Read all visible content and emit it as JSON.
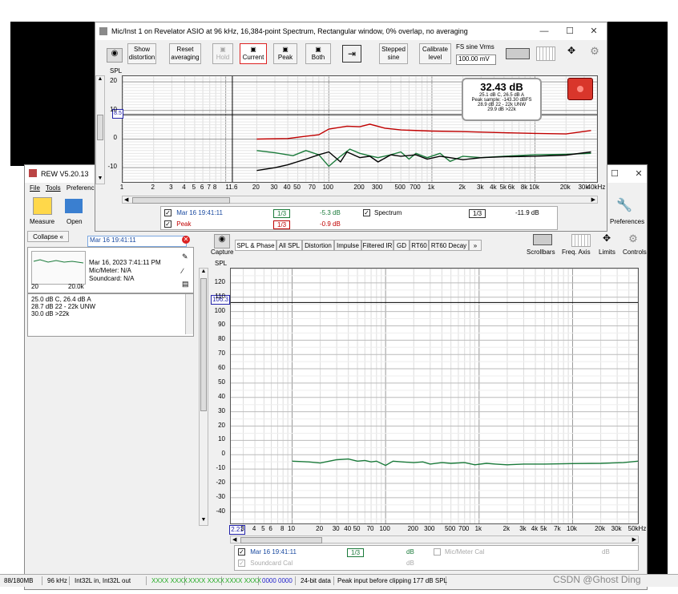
{
  "rta_window": {
    "title": "Mic/Inst 1 on Revelator ASIO at 96 kHz, 16,384-point Spectrum, Rectangular window, 0% overlap, no averaging",
    "buttons": {
      "show_distortion": "Show distortion",
      "reset_averaging": "Reset averaging",
      "hold": "Hold",
      "current": "Current",
      "peak": "Peak",
      "both": "Both",
      "stepped_sine": "Stepped sine",
      "calibrate_level": "Calibrate level"
    },
    "fs_sine_label": "FS sine Vrms",
    "fs_sine_value": "100.00 mV",
    "axis_label": "SPL",
    "y_ticks": [
      "20",
      "10",
      "0",
      "-10"
    ],
    "x_ticks": [
      "1",
      "2",
      "3",
      "4",
      "5",
      "6",
      "7",
      "8",
      "11.6",
      "20",
      "30",
      "40",
      "50",
      "70",
      "100",
      "200",
      "300",
      "500",
      "700",
      "1k",
      "2k",
      "3k",
      "4k",
      "5k",
      "6k",
      "8k",
      "10k",
      "20k",
      "30k",
      "40kHz"
    ],
    "cursor_y": "8.5",
    "readout": {
      "main": "32.43 dB",
      "line1": "25.1 dB C, 26.5 dB A",
      "line2": "Peak sample: -143.30 dBFS",
      "line3": "28.9 dB 22 - 22k UNW",
      "line4": "29.9 dB >22k"
    },
    "legend": {
      "row1_name": "Mar 16 19:41:11",
      "row1_smoothing": "1/3",
      "row1_value": "-5.3 dB",
      "row1_name2": "Spectrum",
      "row1_smoothing2": "1/3",
      "row1_value2": "-11.9 dB",
      "row2_name": "Peak",
      "row2_smoothing": "1/3",
      "row2_value": "-0.9 dB"
    },
    "colors": {
      "current": "#000000",
      "peak": "#c00000",
      "spectrum": "#1a7a3a"
    }
  },
  "rew_window": {
    "title": "REW V5.20.13",
    "menu": [
      "File",
      "Tools",
      "Preferences"
    ],
    "toolbar": {
      "measure": "Measure",
      "open": "Open",
      "preferences": "Preferences"
    },
    "collapse": "Collapse",
    "measurement_name": "Mar 16 19:41:11",
    "meas_info": {
      "date": "Mar 16, 2023 7:41:11 PM",
      "mic": "Mic/Meter: N/A",
      "soundcard": "Soundcard: N/A",
      "thumb_left": "20",
      "thumb_right": "20.0k"
    },
    "notes": [
      "25.0 dB C, 26.4 dB A",
      "28.7 dB 22 - 22k UNW",
      "30.0 dB >22k"
    ],
    "capture": "Capture",
    "tabs": [
      "SPL & Phase",
      "All SPL",
      "Distortion",
      "Impulse",
      "Filtered IR",
      "GD",
      "RT60",
      "RT60 Decay",
      "»"
    ],
    "right_tools": [
      "Scrollbars",
      "Freq. Axis",
      "Limits",
      "Controls"
    ],
    "axis_label": "SPL",
    "cursor_y": "106.3",
    "cursor_x": "2.21",
    "y_ticks": [
      "120",
      "110",
      "100",
      "90",
      "80",
      "70",
      "60",
      "50",
      "40",
      "30",
      "20",
      "10",
      "0",
      "-10",
      "-20",
      "-30",
      "-40"
    ],
    "x_ticks": [
      "3",
      "4",
      "5",
      "6",
      "8",
      "10",
      "20",
      "30",
      "40",
      "50",
      "70",
      "100",
      "200",
      "300",
      "500",
      "700",
      "1k",
      "2k",
      "3k",
      "4k",
      "5k",
      "7k",
      "10k",
      "20k",
      "30k",
      "50kHz"
    ],
    "legend": {
      "row1_name": "Mar 16 19:41:11",
      "row1_smoothing": "1/3",
      "row1_unit": "dB",
      "row1_cal": "Mic/Meter Cal",
      "row1_unit2": "dB",
      "row2_name": "Soundcard Cal",
      "row2_unit": "dB"
    },
    "status": {
      "memory": "88/180MB",
      "rate": "96 kHz",
      "format": "Int32L in, Int32L out",
      "bits1": "XXXX XXXX",
      "bits2": "XXXX XXXX",
      "bits3": "XXXX XXXX",
      "bits4": "XXXX XXXX",
      "bits5": "0000 0000",
      "bitdata": "24-bit data",
      "peak_input": "Peak input before clipping 177 dB SPL"
    }
  },
  "watermark": "CSDN @Ghost Ding"
}
